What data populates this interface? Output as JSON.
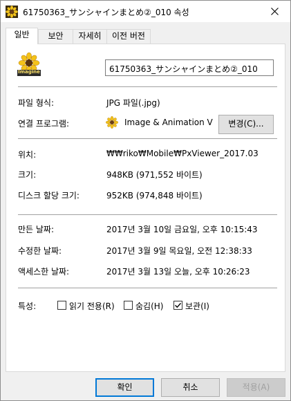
{
  "window": {
    "title": "61750363_サンシャインまとめ②_010 속성",
    "close_icon": "close-icon",
    "file_icon": "sunflower-thumbnail-icon"
  },
  "tabs": [
    "일반",
    "보안",
    "자세히",
    "이전 버전"
  ],
  "general": {
    "filename": "61750363_サンシャインまとめ②_010",
    "thumbnail_caption": "Imagine",
    "file_type_label": "파일 형식:",
    "file_type_value": "JPG 파일(.jpg)",
    "opens_with_label": "연결 프로그램:",
    "opens_with_value": "Image & Animation Vie",
    "change_button": "변경(C)...",
    "location_label": "위치:",
    "location_value": "₩₩riko₩Mobile₩PxViewer_2017.03",
    "size_label": "크기:",
    "size_value": "948KB (971,552 바이트)",
    "size_on_disk_label": "디스크 할당 크기:",
    "size_on_disk_value": "952KB (974,848 바이트)",
    "created_label": "만든 날짜:",
    "created_value": "2017년 3월 10일 금요일, 오후 10:15:43",
    "modified_label": "수정한 날짜:",
    "modified_value": "2017년 3월 9일 목요일, 오전 12:38:33",
    "accessed_label": "액세스한 날짜:",
    "accessed_value": "2017년 3월 13일 오늘, 오후 10:26:23",
    "attributes_label": "특성:",
    "attributes": [
      {
        "label": "읽기 전용(R)",
        "checked": false
      },
      {
        "label": "숨김(H)",
        "checked": false
      },
      {
        "label": "보관(I)",
        "checked": true
      }
    ]
  },
  "footer": {
    "ok": "확인",
    "cancel": "취소",
    "apply": "적용(A)"
  }
}
